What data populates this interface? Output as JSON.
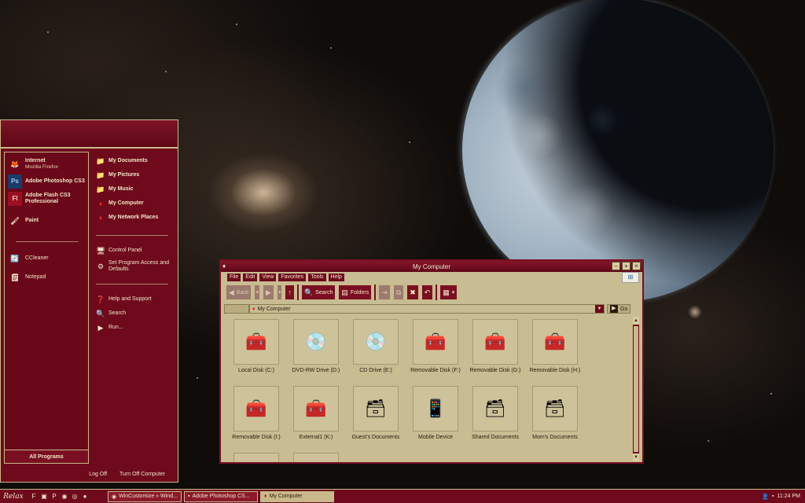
{
  "start_menu": {
    "pinned": [
      {
        "label": "Internet",
        "sub": "Mozilla Firefox",
        "icon": "firefox-icon"
      },
      {
        "label": "Adobe Photoshop CS3",
        "sub": "",
        "icon": "photoshop-icon"
      },
      {
        "label": "Adobe Flash CS3 Professional",
        "sub": "",
        "icon": "flash-icon"
      },
      {
        "label": "Paint",
        "sub": "",
        "icon": "paint-icon"
      }
    ],
    "recent": [
      {
        "label": "CCleaner",
        "icon": "ccleaner-icon"
      },
      {
        "label": "Notepad",
        "icon": "notepad-icon"
      }
    ],
    "all_programs": "All Programs",
    "places": [
      {
        "label": "My Documents",
        "icon": "folder-icon"
      },
      {
        "label": "My Pictures",
        "icon": "folder-icon"
      },
      {
        "label": "My Music",
        "icon": "folder-icon"
      },
      {
        "label": "My Computer",
        "icon": "computer-icon"
      },
      {
        "label": "My Network Places",
        "icon": "network-icon"
      }
    ],
    "system": [
      {
        "label": "Control Panel",
        "icon": "control-panel-icon"
      },
      {
        "label": "Set Program Access and Defaults",
        "icon": "defaults-icon"
      }
    ],
    "help": [
      {
        "label": "Help and Support",
        "icon": "help-icon"
      },
      {
        "label": "Search",
        "icon": "search-icon"
      },
      {
        "label": "Run...",
        "icon": "run-icon"
      }
    ],
    "log_off": "Log Off",
    "turn_off": "Turn Off Computer"
  },
  "window": {
    "title": "My Computer",
    "menus": [
      "File",
      "Edit",
      "View",
      "Favorites",
      "Tools",
      "Help"
    ],
    "toolbar": {
      "back": "Back",
      "search": "Search",
      "folders": "Folders"
    },
    "address": {
      "value": "My Computer",
      "go": "Go"
    },
    "items": [
      {
        "label": "Local Disk (C:)",
        "icon": "hard-disk-icon"
      },
      {
        "label": "DVD-RW Drive (D:)",
        "icon": "dvd-drive-icon"
      },
      {
        "label": "CD Drive (E:)",
        "icon": "cd-drive-icon"
      },
      {
        "label": "Removable Disk (F:)",
        "icon": "removable-disk-icon"
      },
      {
        "label": "Removable Disk (G:)",
        "icon": "removable-disk-icon"
      },
      {
        "label": "Removable Disk (H:)",
        "icon": "removable-disk-icon"
      },
      {
        "label": "Removable Disk (I:)",
        "icon": "removable-disk-icon"
      },
      {
        "label": "External1 (K:)",
        "icon": "hard-disk-icon"
      },
      {
        "label": "Guest's Documents",
        "icon": "documents-folder-icon"
      },
      {
        "label": "Mobile Device",
        "icon": "mobile-device-icon"
      },
      {
        "label": "Shared Documents",
        "icon": "shared-folder-icon"
      },
      {
        "label": "Mom's Documents",
        "icon": "documents-folder-icon"
      }
    ]
  },
  "taskbar": {
    "start": "Relax",
    "tasks": [
      {
        "label": "WinCustomize » Wind...",
        "icon": "browser-icon",
        "active": false
      },
      {
        "label": "Adobe Photoshop CS...",
        "icon": "photoshop-icon",
        "active": false
      },
      {
        "label": "My Computer",
        "icon": "computer-icon",
        "active": true
      }
    ],
    "clock": "11:24 PM"
  },
  "colors": {
    "accent": "#6e0a1c",
    "panel": "#c7bc92",
    "trim": "#c9b98a"
  }
}
